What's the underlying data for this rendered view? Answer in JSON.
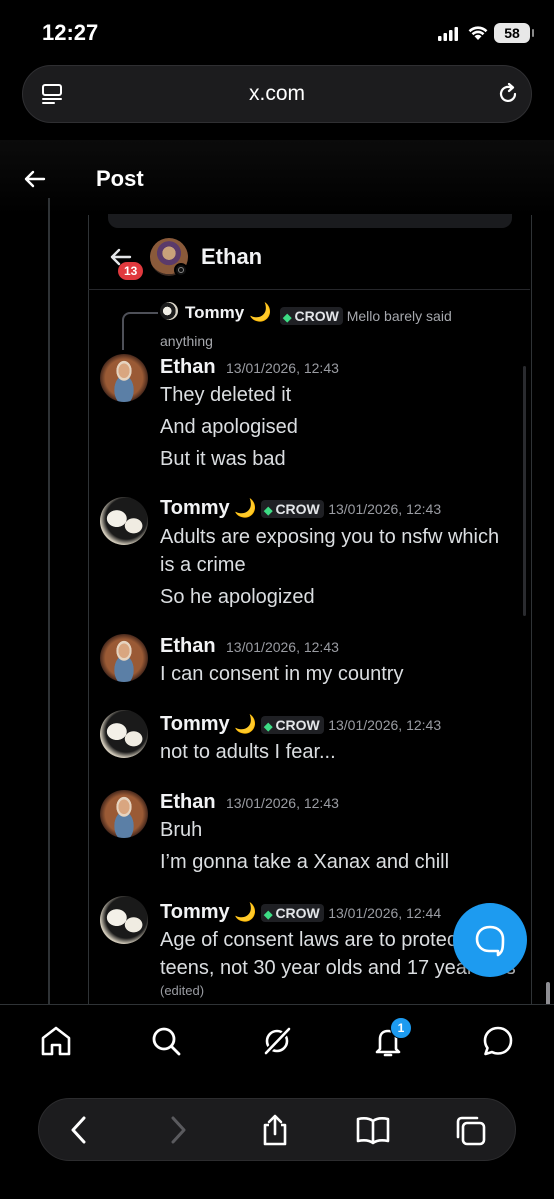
{
  "status_bar": {
    "time": "12:27",
    "battery": "58"
  },
  "browser": {
    "url": "x.com"
  },
  "header": {
    "title": "Post"
  },
  "chat": {
    "title": "Ethan",
    "back_badge": "13",
    "reply_preview": {
      "author": "Tommy",
      "emoji": "🌙",
      "tag": "CROW",
      "text": "Mello barely said anything"
    },
    "messages": [
      {
        "author": "Ethan",
        "timestamp": "13/01/2026, 12:43",
        "lines": [
          "They deleted it",
          "And apologised",
          "But it was bad"
        ]
      },
      {
        "author": "Tommy",
        "emoji": "🌙",
        "tag": "CROW",
        "timestamp": "13/01/2026, 12:43",
        "lines": [
          "Adults are exposing you to nsfw which",
          "is a crime",
          "So he apologized"
        ]
      },
      {
        "author": "Ethan",
        "timestamp": "13/01/2026, 12:43",
        "lines": [
          "I can consent in my country"
        ]
      },
      {
        "author": "Tommy",
        "emoji": "🌙",
        "tag": "CROW",
        "timestamp": "13/01/2026, 12:43",
        "lines": [
          "not to adults I fear..."
        ]
      },
      {
        "author": "Ethan",
        "timestamp": "13/01/2026, 12:43",
        "lines": [
          "Bruh",
          "I’m gonna take a Xanax and chill"
        ]
      },
      {
        "author": "Tommy",
        "emoji": "🌙",
        "tag": "CROW",
        "timestamp": "13/01/2026, 12:44",
        "lines": [
          "Age of consent laws are to protect",
          "teens, not 30 year olds and 17 year olds"
        ],
        "edited": "(edited)"
      }
    ]
  },
  "nav": {
    "notifications_count": "1"
  },
  "colors": {
    "accent": "#1d9bf0",
    "badge_red": "#e0393e",
    "background": "#000000"
  }
}
